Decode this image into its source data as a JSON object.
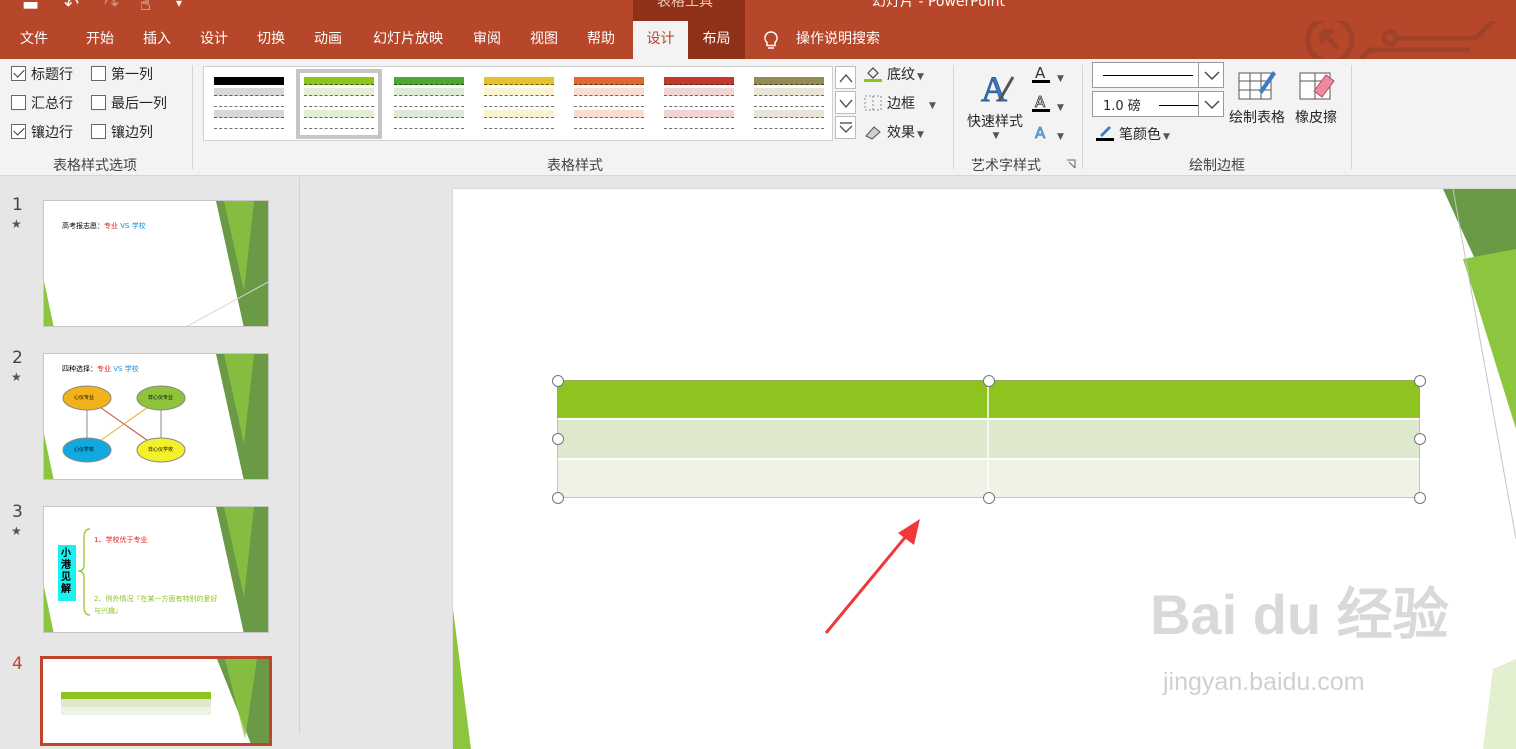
{
  "titlebar": {
    "context_group": "表格工具",
    "doc_title": "幻灯片 - PowerPoint"
  },
  "tabs": [
    {
      "label": "文件",
      "name": "tab-file"
    },
    {
      "label": "开始",
      "name": "tab-home"
    },
    {
      "label": "插入",
      "name": "tab-insert"
    },
    {
      "label": "设计",
      "name": "tab-design"
    },
    {
      "label": "切换",
      "name": "tab-transitions"
    },
    {
      "label": "动画",
      "name": "tab-animations"
    },
    {
      "label": "幻灯片放映",
      "name": "tab-slideshow"
    },
    {
      "label": "审阅",
      "name": "tab-review"
    },
    {
      "label": "视图",
      "name": "tab-view"
    },
    {
      "label": "帮助",
      "name": "tab-help"
    },
    {
      "label": "设计",
      "name": "tab-table-design"
    },
    {
      "label": "布局",
      "name": "tab-table-layout"
    }
  ],
  "tell_me": "操作说明搜索",
  "ribbon": {
    "style_options": {
      "label": "表格样式选项",
      "header_row": {
        "label": "标题行",
        "checked": true
      },
      "first_column": {
        "label": "第一列",
        "checked": false
      },
      "total_row": {
        "label": "汇总行",
        "checked": false
      },
      "last_column": {
        "label": "最后一列",
        "checked": false
      },
      "banded_rows": {
        "label": "镶边行",
        "checked": true
      },
      "banded_columns": {
        "label": "镶边列",
        "checked": false
      }
    },
    "table_styles": {
      "label": "表格样式",
      "swatches": [
        {
          "header": "#000000",
          "band": "#d8d8d8"
        },
        {
          "header": "#8fc31f",
          "band": "#e3eed4"
        },
        {
          "header": "#4ea72e",
          "band": "#dcebd5"
        },
        {
          "header": "#e6c12f",
          "band": "#fbf2d0"
        },
        {
          "header": "#e0682d",
          "band": "#f9ddd0"
        },
        {
          "header": "#c0392b",
          "band": "#f2d5d2"
        },
        {
          "header": "#948a54",
          "band": "#e8e4d6"
        }
      ],
      "shading": "底纹",
      "borders": "边框",
      "effects": "效果"
    },
    "wordart": {
      "label": "艺术字样式",
      "quick_styles": "快速样式"
    },
    "draw_borders": {
      "label": "绘制边框",
      "pen_weight": "1.0 磅",
      "pen_color": "笔颜色",
      "draw_table": "绘制表格",
      "eraser": "橡皮擦"
    }
  },
  "slides": [
    {
      "number": "1",
      "title_a": "高考报志愿：",
      "title_b": "专业",
      "title_c": " VS ",
      "title_d": "学校"
    },
    {
      "number": "2",
      "title_a": "四种选择：",
      "title_b": "专业",
      "title_c": " VS ",
      "title_d": "学校",
      "nodes": [
        "心仪专业",
        "非心仪专业",
        "心仪学校",
        "非心仪学校"
      ]
    },
    {
      "number": "3",
      "side": "小港见解",
      "point1": "1、学校优于专业",
      "point2": "2、例外情况『在某一方面有特别的爱好与兴趣』"
    },
    {
      "number": "4"
    }
  ],
  "watermark": {
    "main": "Bai du 经验",
    "sub": "jingyan.baidu.com"
  },
  "colors": {
    "accent": "#b7472a",
    "table_header": "#8fc31f",
    "band1": "#dde8cd",
    "band2": "#eef3e6"
  }
}
